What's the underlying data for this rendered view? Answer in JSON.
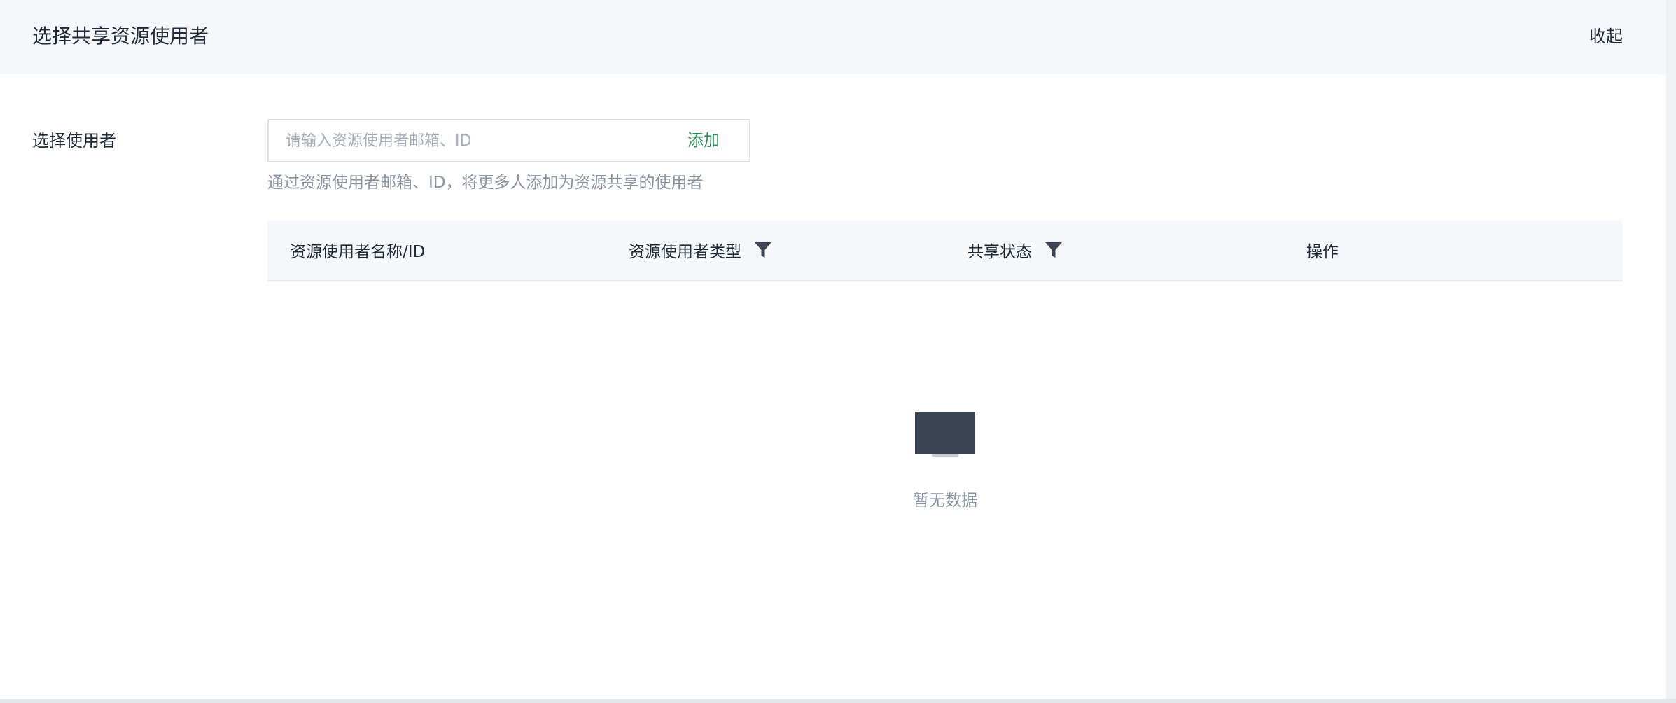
{
  "header": {
    "title": "选择共享资源使用者",
    "collapse_label": "收起"
  },
  "form": {
    "user_label": "选择使用者",
    "input_placeholder": "请输入资源使用者邮箱、ID",
    "input_value": "",
    "add_label": "添加",
    "help_text": "通过资源使用者邮箱、ID，将更多人添加为资源共享的使用者"
  },
  "table": {
    "columns": [
      {
        "label": "资源使用者名称/ID",
        "filter": false
      },
      {
        "label": "资源使用者类型",
        "filter": true
      },
      {
        "label": "共享状态",
        "filter": true
      },
      {
        "label": "操作",
        "filter": false
      }
    ],
    "rows": [],
    "empty_text": "暂无数据"
  },
  "icons": {
    "filter": "funnel-filter-icon",
    "empty": "monitor-icon"
  },
  "colors": {
    "accent": "#2e8e5a",
    "header_bg": "#f5f7fa",
    "icon_dark": "#3a4453"
  }
}
